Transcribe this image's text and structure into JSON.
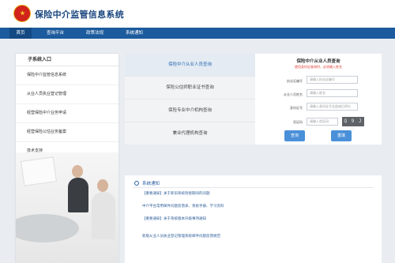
{
  "header": {
    "title": "保险中介监管信息系统",
    "emblem": "national-emblem-icon"
  },
  "nav": {
    "items": [
      "首页",
      "查询平台",
      "政策法规",
      "系统通知"
    ],
    "active_index": 0
  },
  "sidebar": {
    "title": "子系统入口",
    "items": [
      "保险中介监管信息系统",
      "从业人员执业登记管理",
      "经营保险中介业务申请",
      "经营保险公估业务备案",
      "技术支持"
    ]
  },
  "tabs": {
    "items": [
      "保险中介从业人员查询",
      "保险公估师职业证书查询",
      "保险专业中介机构查询",
      "兼业代理机构查询"
    ],
    "active_index": 0
  },
  "query": {
    "title": "保险中介从业人员查询",
    "note": "使用身份证查询时，必须输入姓名",
    "fields": [
      {
        "label": "执业证编号",
        "placeholder": "请输入执业证编号"
      },
      {
        "label": "从业人员姓名",
        "placeholder": "请输入姓名"
      },
      {
        "label": "身份证号",
        "placeholder": "请输入身份证号全部或后四位"
      },
      {
        "label": "验证码",
        "placeholder": "请输入验证码"
      }
    ],
    "captcha": "Q 9 J 7",
    "search_label": "查询",
    "reset_label": "重填"
  },
  "news": {
    "title": "系统通知",
    "items": [
      "【重要通知】关于新旧系统衔接期间的问题",
      "中介平台常用邮件问题反馈表、系统手册、学习资料",
      "【重要通知】关于系统版本升级事项通知",
      "新版从业人员执业登记管理系统邮件问题反馈规范"
    ]
  },
  "colors": {
    "nav_bg": "#1c5b9d",
    "accent": "#4a90d9",
    "title": "#19467e",
    "warning": "#e03c31"
  }
}
